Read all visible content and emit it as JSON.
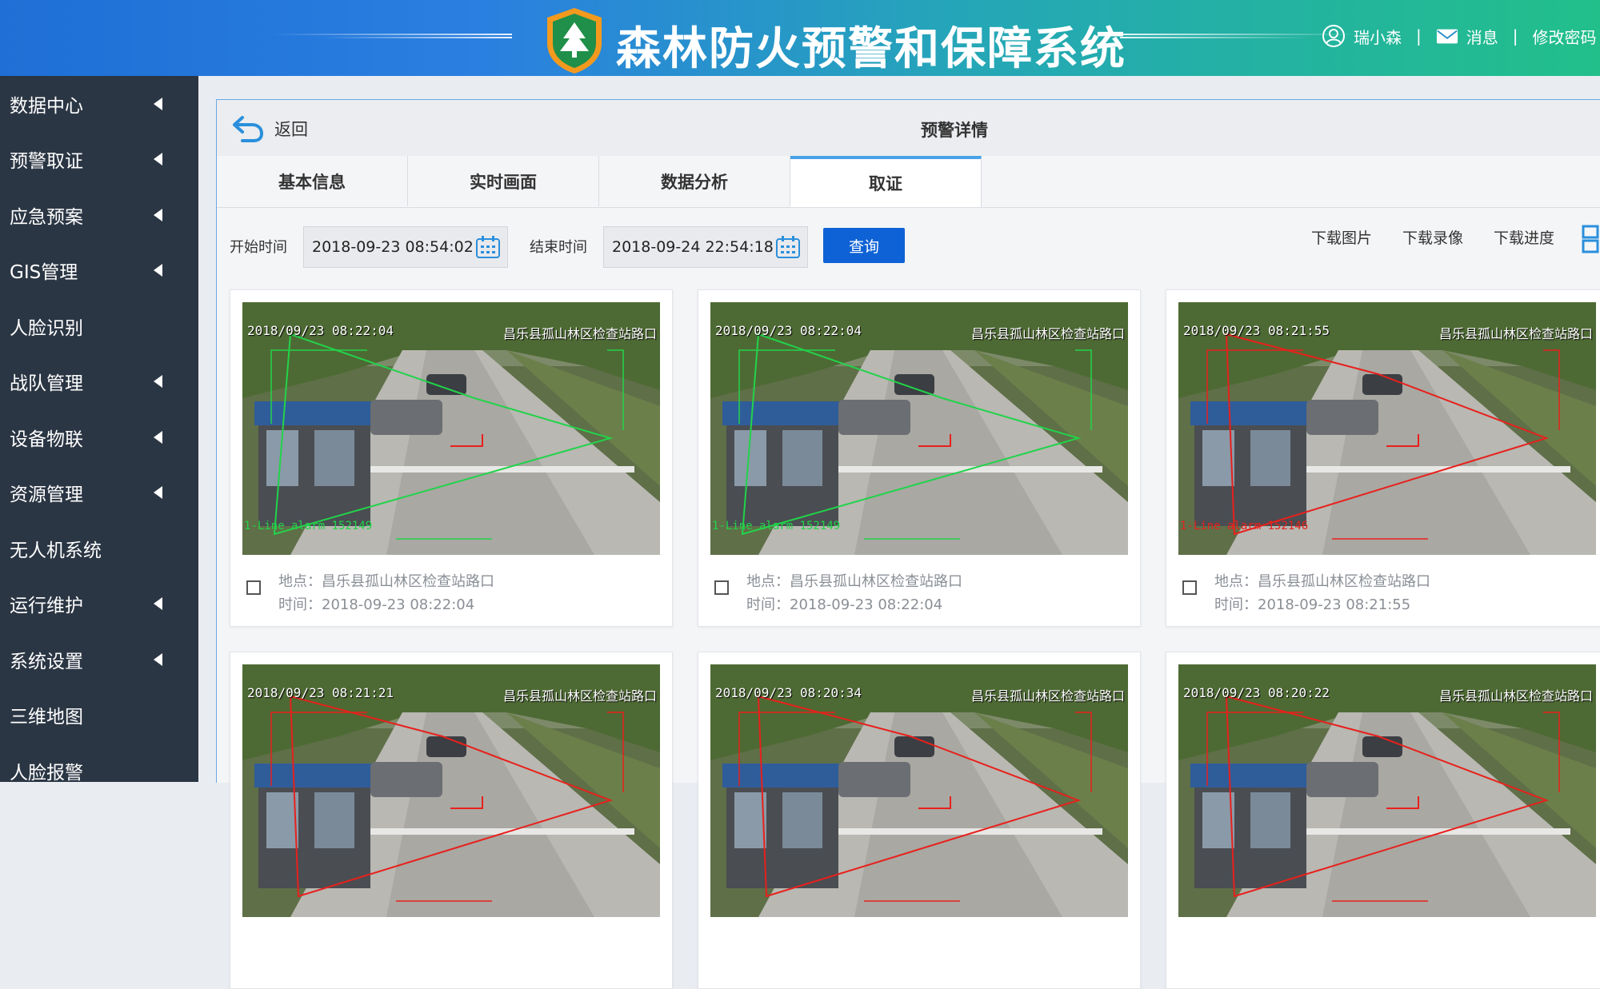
{
  "header": {
    "title": "森林防火预警和保障系统",
    "user_name": "瑞小森",
    "messages_label": "消息",
    "change_password_label": "修改密码",
    "separator": "|"
  },
  "sidebar": {
    "items": [
      {
        "label": "数据中心",
        "has_arrow": true
      },
      {
        "label": "预警取证",
        "has_arrow": true
      },
      {
        "label": "应急预案",
        "has_arrow": true
      },
      {
        "label": "GIS管理",
        "has_arrow": true
      },
      {
        "label": "人脸识别",
        "has_arrow": false
      },
      {
        "label": "战队管理",
        "has_arrow": true
      },
      {
        "label": "设备物联",
        "has_arrow": true
      },
      {
        "label": "资源管理",
        "has_arrow": true
      },
      {
        "label": "无人机系统",
        "has_arrow": false
      },
      {
        "label": "运行维护",
        "has_arrow": true
      },
      {
        "label": "系统设置",
        "has_arrow": true
      },
      {
        "label": "三维地图",
        "has_arrow": false
      },
      {
        "label": "人脸报警",
        "has_arrow": false
      }
    ]
  },
  "panel": {
    "back_label": "返回",
    "title": "预警详情",
    "tabs": [
      {
        "label": "基本信息",
        "active": false
      },
      {
        "label": "实时画面",
        "active": false
      },
      {
        "label": "数据分析",
        "active": false
      },
      {
        "label": "取证",
        "active": true
      }
    ]
  },
  "filter": {
    "start_label": "开始时间",
    "start_value": "2018-09-23 08:54:02",
    "end_label": "结束时间",
    "end_value": "2018-09-24 22:54:18",
    "query_label": "查询",
    "download_image": "下载图片",
    "download_video": "下载录像",
    "download_progress": "下载进度"
  },
  "cards": [
    {
      "overlay_time": "2018/09/23 08:22:04",
      "overlay_location": "昌乐县孤山林区检查站路口",
      "alarm_text": "1-Line alarm 152149",
      "line_color": "#22d34a",
      "location": "地点：昌乐县孤山林区检查站路口",
      "time": "时间：2018-09-23 08:22:04"
    },
    {
      "overlay_time": "2018/09/23 08:22:04",
      "overlay_location": "昌乐县孤山林区检查站路口",
      "alarm_text": "1-Line alarm 152149",
      "line_color": "#22d34a",
      "location": "地点：昌乐县孤山林区检查站路口",
      "time": "时间：2018-09-23 08:22:04"
    },
    {
      "overlay_time": "2018/09/23 08:21:55",
      "overlay_location": "昌乐县孤山林区检查站路口",
      "alarm_text": "1-Line alarm 152146",
      "line_color": "#e8201c",
      "location": "地点：昌乐县孤山林区检查站路口",
      "time": "时间：2018-09-23 08:21:55"
    },
    {
      "overlay_time": "2018/09/23 08:21:21",
      "overlay_location": "昌乐县孤山林区检查站路口",
      "line_color": "#e8201c"
    },
    {
      "overlay_time": "2018/09/23 08:20:34",
      "overlay_location": "昌乐县孤山林区检查站路口",
      "line_color": "#e8201c"
    },
    {
      "overlay_time": "2018/09/23 08:20:22",
      "overlay_location": "昌乐县孤山林区检查站路口",
      "line_color": "#e8201c"
    }
  ]
}
